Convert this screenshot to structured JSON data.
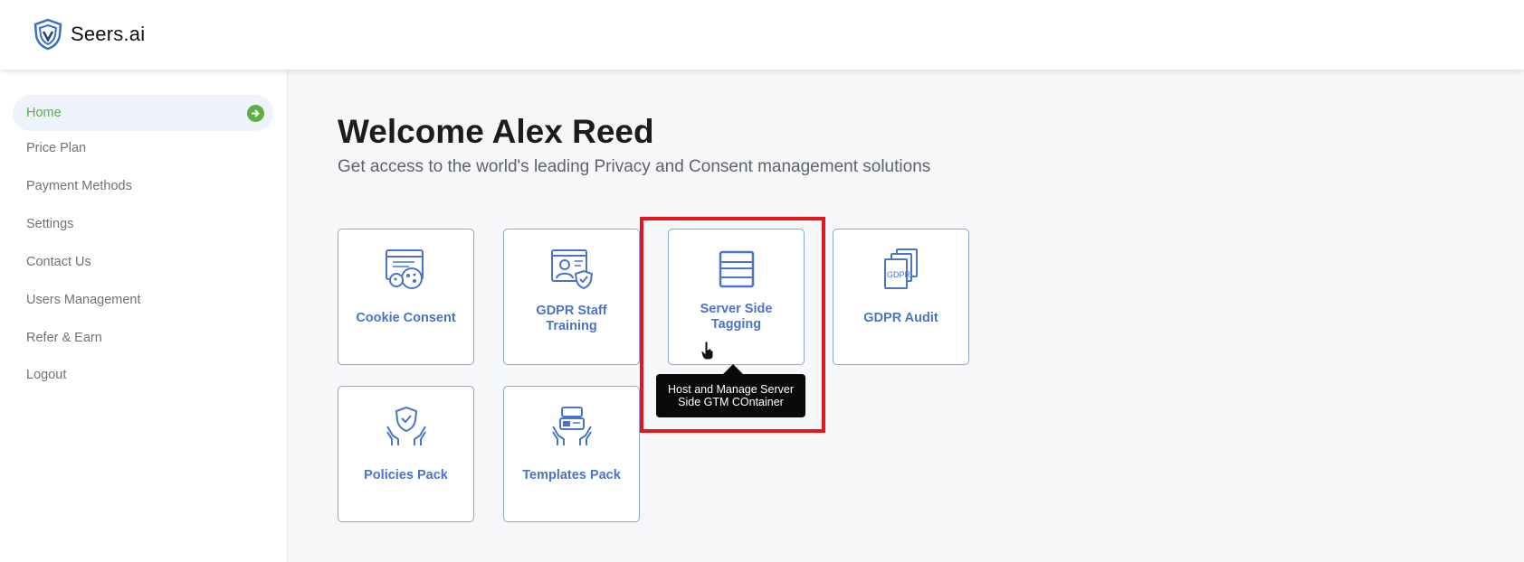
{
  "app": {
    "logo_text": "Seers.ai"
  },
  "sidebar": {
    "items": [
      {
        "label": "Home",
        "active": true
      },
      {
        "label": "Price Plan"
      },
      {
        "label": "Payment Methods"
      },
      {
        "label": "Settings"
      },
      {
        "label": "Contact Us"
      },
      {
        "label": "Users Management"
      },
      {
        "label": "Refer & Earn"
      },
      {
        "label": "Logout"
      }
    ]
  },
  "main": {
    "welcome": "Welcome Alex Reed",
    "subtitle": "Get access to the world's leading Privacy and Consent management solutions",
    "cards": [
      {
        "label": "Cookie Consent",
        "icon": "cookie-browser-icon"
      },
      {
        "label": "GDPR Staff Training",
        "icon": "staff-training-icon"
      },
      {
        "label": "Server Side Tagging",
        "icon": "server-tagging-icon"
      },
      {
        "label": "GDPR Audit",
        "icon": "gdpr-docs-icon"
      },
      {
        "label": "Policies Pack",
        "icon": "shield-hands-icon"
      },
      {
        "label": "Templates Pack",
        "icon": "templates-hands-icon"
      }
    ],
    "tooltip": "Host and Manage Server Side GTM COntainer"
  },
  "colors": {
    "accent_green": "#5bb043",
    "card_blue": "#4a73c9",
    "card_border": "#8aa6d6",
    "highlight_red": "#e2171e"
  }
}
